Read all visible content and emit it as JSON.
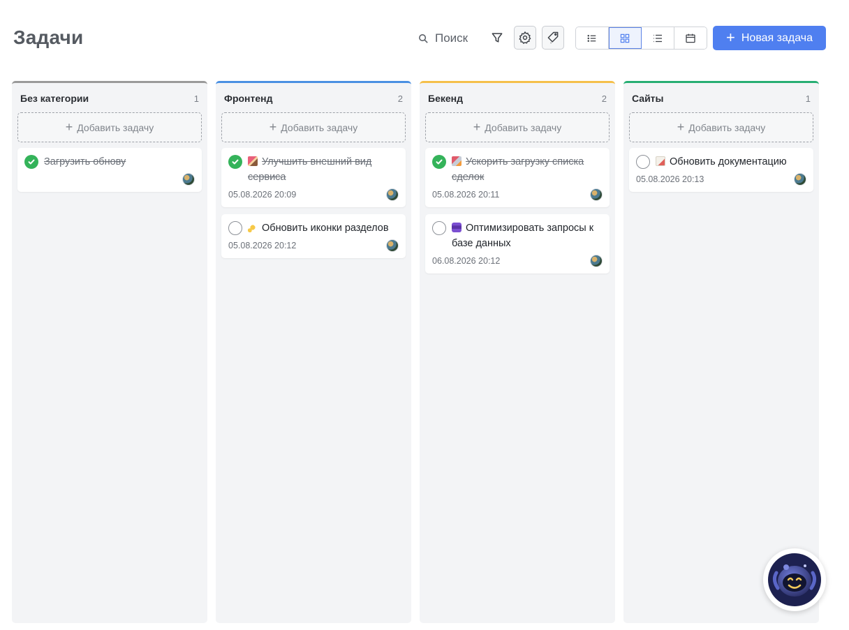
{
  "page_title": "Задачи",
  "toolbar": {
    "search_label": "Поиск",
    "new_task_label": "Новая задача",
    "views": [
      "list-view-icon",
      "board-view-icon",
      "table-view-icon",
      "calendar-view-icon"
    ],
    "active_view": "board-view-icon"
  },
  "columns": [
    {
      "title": "Без категории",
      "count": "1",
      "color": "#9a9a9a",
      "add_label": "Добавить задачу",
      "cards": [
        {
          "title": "Загрузить обнову",
          "date": "",
          "done": true,
          "emoji": ""
        }
      ]
    },
    {
      "title": "Фронтенд",
      "count": "2",
      "color": "#4a90e2",
      "add_label": "Добавить задачу",
      "cards": [
        {
          "title": "Улучшить внешний вид сервиса",
          "date": "05.08.2026 20:09",
          "done": true,
          "emoji": "paintbrush"
        },
        {
          "title": "Обновить иконки разделов",
          "date": "05.08.2026 20:12",
          "done": false,
          "emoji": "sparkles"
        }
      ]
    },
    {
      "title": "Бекенд",
      "count": "2",
      "color": "#f5c04a",
      "add_label": "Добавить задачу",
      "cards": [
        {
          "title": "Ускорить загрузку списка сделок",
          "date": "05.08.2026 20:11",
          "done": true,
          "emoji": "rocket"
        },
        {
          "title": "Оптимизировать запросы к базе данных",
          "date": "06.08.2026 20:12",
          "done": false,
          "emoji": "database"
        }
      ]
    },
    {
      "title": "Сайты",
      "count": "1",
      "color": "#27ae73",
      "add_label": "Добавить задачу",
      "cards": [
        {
          "title": "Обновить документацию",
          "date": "05.08.2026 20:13",
          "done": false,
          "emoji": "memo"
        }
      ]
    }
  ]
}
